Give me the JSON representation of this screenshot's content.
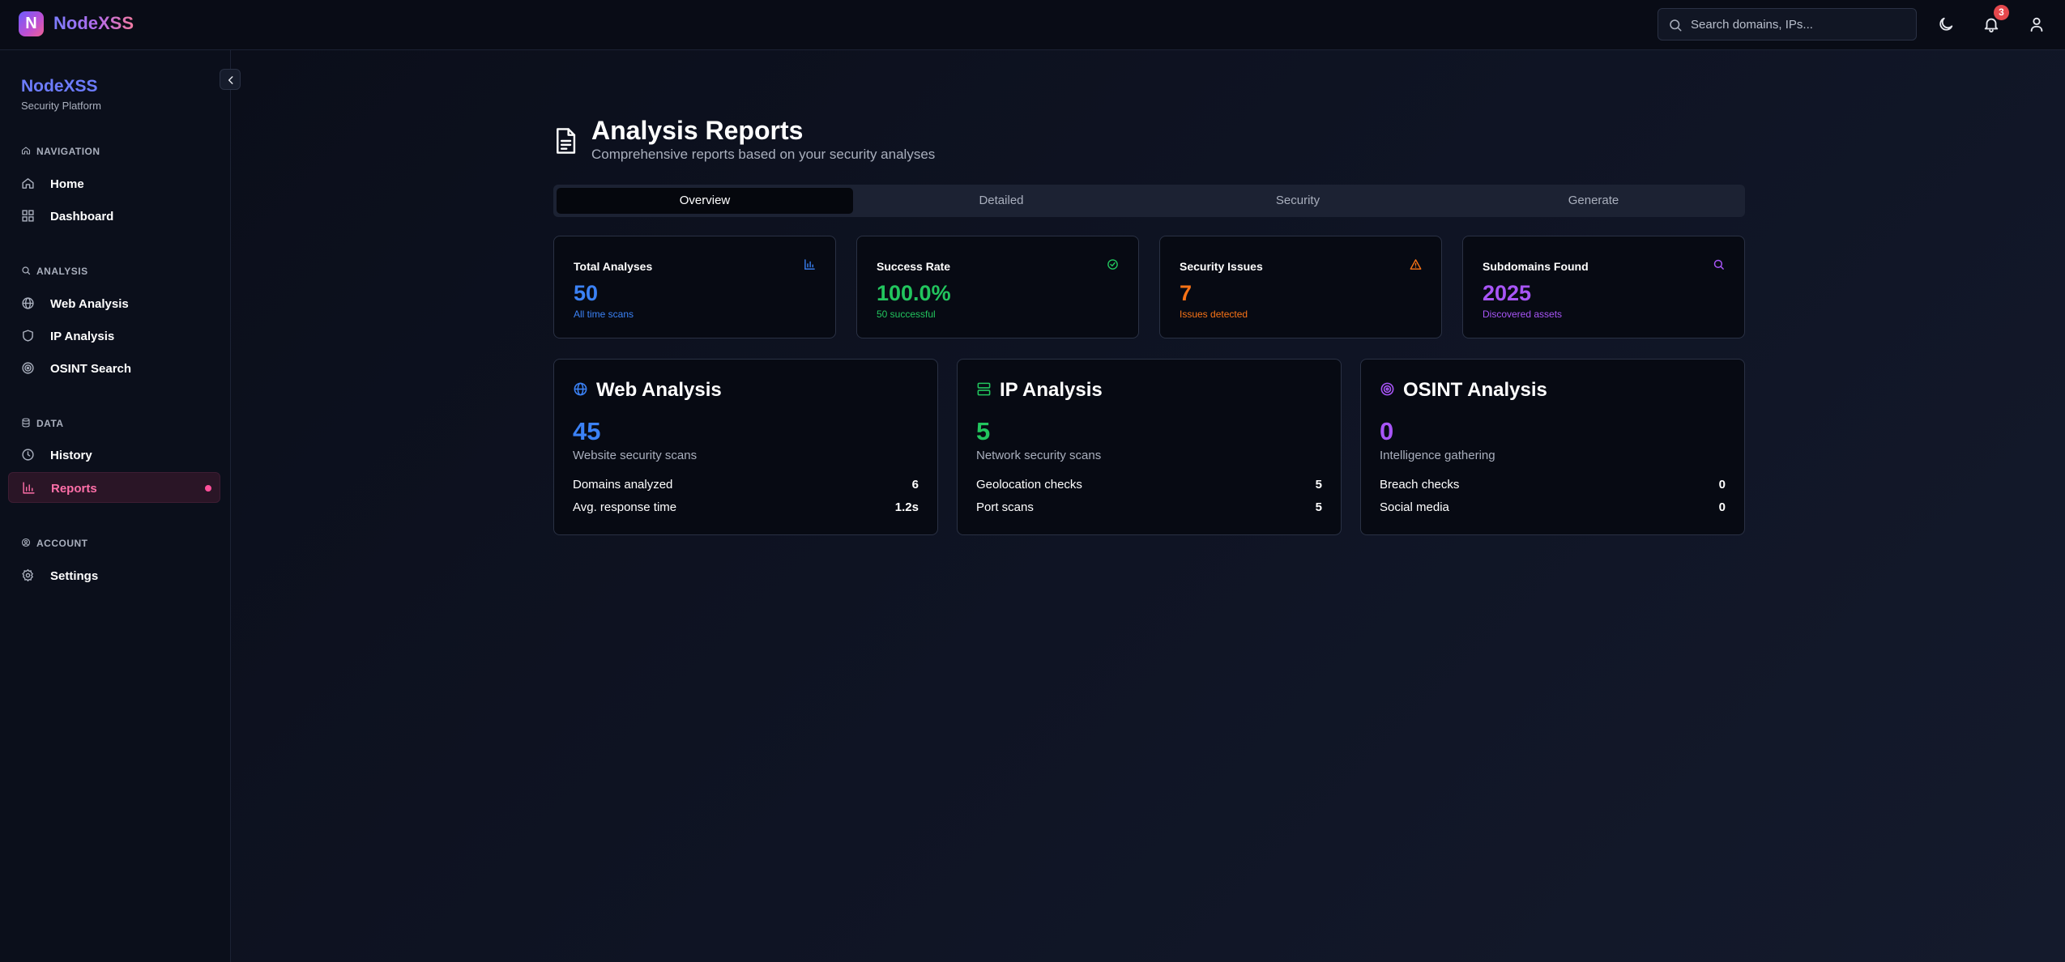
{
  "app": {
    "logo_letter": "N",
    "name": "NodeXSS"
  },
  "topbar": {
    "search_placeholder": "Search domains, IPs...",
    "notification_count": "3"
  },
  "sidebar": {
    "brand": "NodeXSS",
    "tagline": "Security Platform",
    "sections": [
      {
        "heading": "NAVIGATION",
        "items": [
          "Home",
          "Dashboard"
        ]
      },
      {
        "heading": "ANALYSIS",
        "items": [
          "Web Analysis",
          "IP Analysis",
          "OSINT Search"
        ]
      },
      {
        "heading": "DATA",
        "items": [
          "History",
          "Reports"
        ]
      },
      {
        "heading": "ACCOUNT",
        "items": [
          "Settings"
        ]
      }
    ],
    "active_item": "Reports"
  },
  "page": {
    "title": "Analysis Reports",
    "subtitle": "Comprehensive reports based on your security analyses"
  },
  "tabs": [
    "Overview",
    "Detailed",
    "Security",
    "Generate"
  ],
  "active_tab": "Overview",
  "stats": [
    {
      "title": "Total Analyses",
      "value": "50",
      "note": "All time scans",
      "color": "#3b82f6",
      "icon": "bar-chart-icon"
    },
    {
      "title": "Success Rate",
      "value": "100.0%",
      "note": "50 successful",
      "color": "#22c55e",
      "icon": "check-circle-icon"
    },
    {
      "title": "Security Issues",
      "value": "7",
      "note": "Issues detected",
      "color": "#f97316",
      "icon": "warning-triangle-icon"
    },
    {
      "title": "Subdomains Found",
      "value": "2025",
      "note": "Discovered assets",
      "color": "#a855f7",
      "icon": "search-icon"
    }
  ],
  "sections": [
    {
      "title": "Web Analysis",
      "value": "45",
      "desc": "Website security scans",
      "color": "#3b82f6",
      "icon": "globe-icon",
      "rows": [
        {
          "label": "Domains analyzed",
          "value": "6"
        },
        {
          "label": "Avg. response time",
          "value": "1.2s"
        }
      ]
    },
    {
      "title": "IP Analysis",
      "value": "5",
      "desc": "Network security scans",
      "color": "#22c55e",
      "icon": "server-icon",
      "rows": [
        {
          "label": "Geolocation checks",
          "value": "5"
        },
        {
          "label": "Port scans",
          "value": "5"
        }
      ]
    },
    {
      "title": "OSINT Analysis",
      "value": "0",
      "desc": "Intelligence gathering",
      "color": "#a855f7",
      "icon": "target-icon",
      "rows": [
        {
          "label": "Breach checks",
          "value": "0"
        },
        {
          "label": "Social media",
          "value": "0"
        }
      ]
    }
  ]
}
